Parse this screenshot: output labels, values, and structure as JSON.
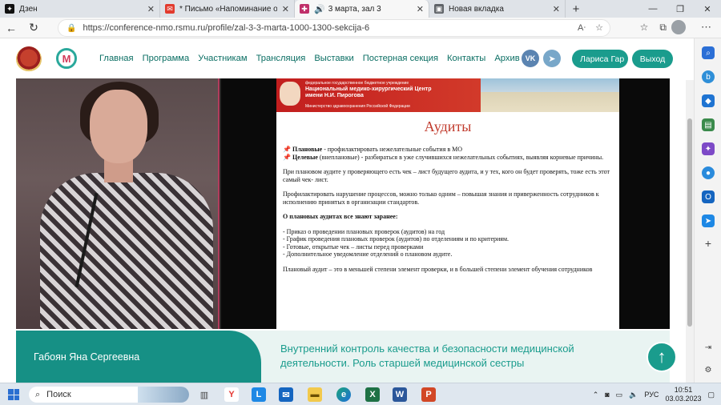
{
  "browser": {
    "tabs": [
      {
        "label": "Дзен",
        "icon": "dzen-icon",
        "color": "#111111",
        "active": false
      },
      {
        "label": "* Письмо «Напоминание о нач",
        "icon": "mail-icon",
        "color": "#e23b2e",
        "active": false
      },
      {
        "label": "3 марта, зал 3",
        "icon": "sound-icon",
        "color": "#c0306a",
        "active": true
      },
      {
        "label": "Новая вкладка",
        "icon": "newtab-icon",
        "color": "#5f6368",
        "active": false
      }
    ],
    "url": "https://conference-nmo.rsmu.ru/profile/zal-3-3-marta-1000-1300-sekcija-6"
  },
  "site": {
    "nav": [
      "Главная",
      "Программа",
      "Участникам",
      "Трансляция",
      "Выставки",
      "Постерная секция",
      "Контакты",
      "Архив"
    ],
    "user_button": "Лариса Гар",
    "logout_button": "Выход",
    "vk_label": "VK",
    "accent_color": "#1a9c8d"
  },
  "slide": {
    "org_line1": "федеральное государственное бюджетное учреждение",
    "org_line2": "Национальный медико-хирургический Центр имени Н.И. Пирогова",
    "org_line3": "Министерство здравоохранения Российской Федерации",
    "title": "Аудиты",
    "planned_label": "Плановые",
    "planned_text": " -  профилактировать  нежелательные события в МО",
    "unplanned_label": "Целевые",
    "unplanned_text": " (внеплановые) - разбираться в уже случившихся  нежелательных событиях, выявляя корневые причины.",
    "para1": "При плановом аудите  у проверяющего  есть чек – лист будущего  аудита, и у тех,  кого он будет проверять,  тоже есть этот самый чек-  лист.",
    "para2": "Профилактировать нарушение процессов,  можно только одним – повышая знания и приверженность сотрудников  к исполнению  принятых в организации стандартов.",
    "known_heading": "О плановых аудитах все знают   заранее:",
    "list": [
      "- Приказ о проведении плановых проверок (аудитов)    на год",
      "- График  проведения плановых  проверок (аудитов)    по отделениям и по критериям.",
      "- Готовые, открытые чек – листы перед проверками",
      "- Дополнительное уведомление отделений о плановом аудите."
    ],
    "para3": "Плановый аудит – это в меньшей степени элемент проверки, и в большей степени элемент обучения сотрудников"
  },
  "speaker": {
    "name": "Габоян Яна Сергеевна",
    "talk_title": "Внутренний контроль качества и безопасности медицинской деятельности. Роль старшей медицинской сестры"
  },
  "taskbar": {
    "search_placeholder": "Поиск",
    "language": "РУС",
    "time": "10:51",
    "date": "03.03.2023",
    "apps": [
      "yandex-browser",
      "l-app",
      "mail-app",
      "file-explorer",
      "edge",
      "excel",
      "word",
      "powerpoint"
    ]
  }
}
